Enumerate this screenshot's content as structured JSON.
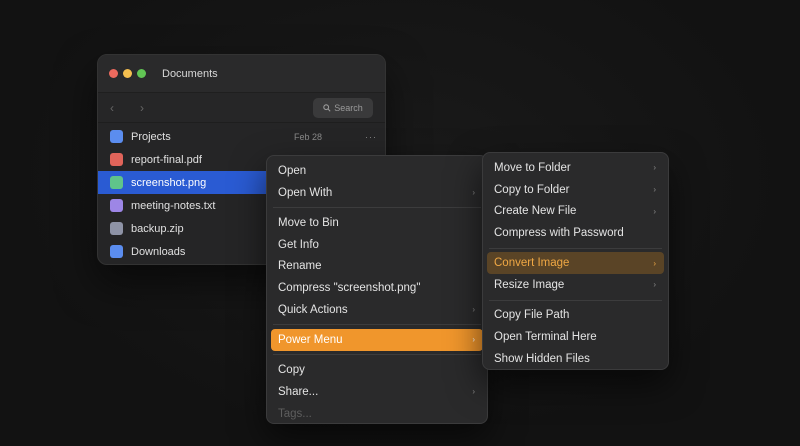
{
  "window": {
    "title": "Documents",
    "search_label": "Search",
    "back_glyph": "‹",
    "forward_glyph": "›"
  },
  "files": [
    {
      "name": "Projects",
      "color": "#5b8def",
      "date": "Feb 28",
      "more": "···"
    },
    {
      "name": "report-final.pdf",
      "color": "#e0645a"
    },
    {
      "name": "screenshot.png",
      "color": "#5fc48a",
      "selected": true
    },
    {
      "name": "meeting-notes.txt",
      "color": "#9d86e6"
    },
    {
      "name": "backup.zip",
      "color": "#8e93a6"
    },
    {
      "name": "Downloads",
      "color": "#5b8def"
    }
  ],
  "context_menu": {
    "items": [
      {
        "label": "Open"
      },
      {
        "label": "Open With",
        "submenu": "›"
      },
      {
        "label": "Move to Bin"
      },
      {
        "label": "Get Info"
      },
      {
        "label": "Rename"
      },
      {
        "label": "Compress \"screenshot.png\""
      },
      {
        "label": "Quick Actions",
        "submenu": "›"
      },
      {
        "label": "Power Menu",
        "submenu": "›",
        "highlighted": true
      },
      {
        "label": "Copy"
      },
      {
        "label": "Share...",
        "submenu": "›"
      },
      {
        "label": "Tags...",
        "disabled": true
      }
    ]
  },
  "power_submenu": {
    "items": [
      {
        "label": "Move to Folder",
        "submenu": "›"
      },
      {
        "label": "Copy to Folder",
        "submenu": "›"
      },
      {
        "label": "Create New File",
        "submenu": "›"
      },
      {
        "label": "Compress with Password"
      },
      {
        "label": "Convert Image",
        "submenu": "›",
        "highlighted": true
      },
      {
        "label": "Resize Image",
        "submenu": "›"
      },
      {
        "label": "Copy File Path"
      },
      {
        "label": "Open Terminal Here"
      },
      {
        "label": "Show Hidden Files"
      }
    ]
  },
  "colors": {
    "accent_selection": "#2a5bd3",
    "menu_highlight": "#f0962c",
    "submenu_highlight_text": "#f0a844"
  }
}
